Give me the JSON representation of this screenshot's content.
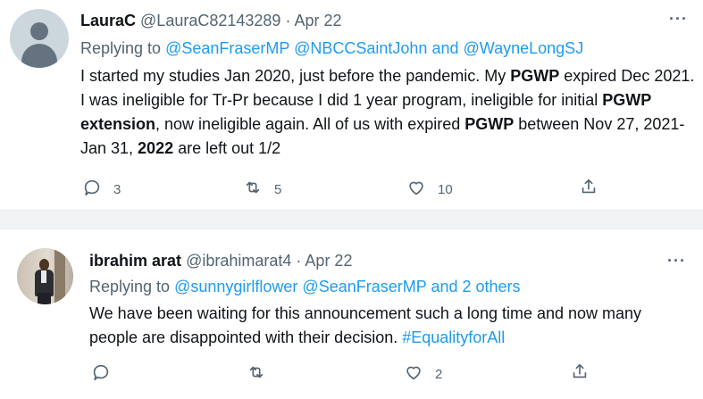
{
  "tweets": [
    {
      "author_name": "LauraC",
      "handle": "@LauraC82143289",
      "separator": "·",
      "date": "Apr 22",
      "more_label": "···",
      "replying_prefix": "Replying to",
      "mentions": [
        "@SeanFraserMP",
        "@NBCCSaintJohn",
        "and",
        "@WayneLongSJ"
      ],
      "body": {
        "t1": "I started my studies Jan 2020, just before the pandemic. My ",
        "b1": "PGWP",
        "t2": " expired Dec 2021. I was ineligible for Tr-Pr because I did 1 year program, ineligible for initial ",
        "b2": "PGWP extension",
        "t3": ", now ineligible again. All of us with expired ",
        "b3": "PGWP",
        "t4": " between Nov 27, 2021-Jan 31, ",
        "b4": "2022",
        "t5": " are left out 1/2"
      },
      "actions": {
        "reply_count": "3",
        "retweet_count": "5",
        "like_count": "10"
      }
    },
    {
      "author_name": "ibrahim arat",
      "handle": "@ibrahimarat4",
      "separator": "·",
      "date": "Apr 22",
      "more_label": "···",
      "replying_prefix": "Replying to",
      "mentions": [
        "@sunnygirlflower",
        "@SeanFraserMP",
        "and 2 others"
      ],
      "body": {
        "t1": "We have been waiting for this announcement such a long time and now many people are disappointed with their decision. ",
        "hashtag": "#EqualityforAll"
      },
      "actions": {
        "reply_count": "",
        "retweet_count": "",
        "like_count": "2"
      }
    }
  ],
  "colors": {
    "accent": "#1d9bf0",
    "text": "#0f1419",
    "muted": "#536471",
    "separator_bg": "#f1f3f5"
  },
  "icons": [
    "default-avatar-icon",
    "more-icon",
    "reply-icon",
    "retweet-icon",
    "like-icon",
    "share-icon"
  ]
}
